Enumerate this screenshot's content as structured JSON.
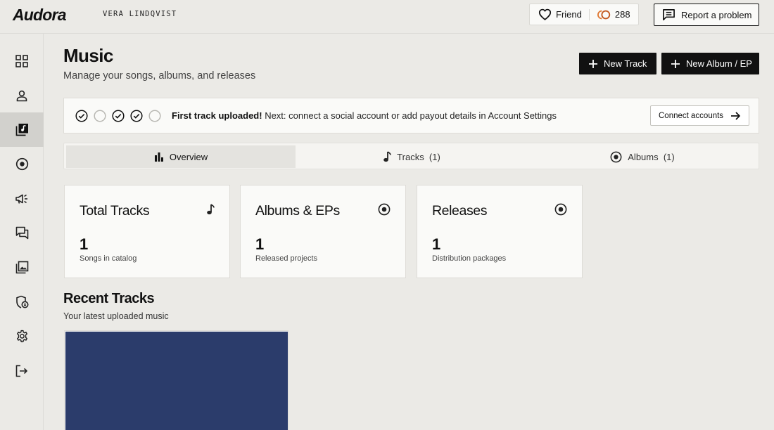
{
  "app": {
    "name": "Audora",
    "user_name": "VERA LINDQVIST"
  },
  "header": {
    "friend_label": "Friend",
    "coins": "288",
    "report_label": "Report a problem"
  },
  "sidebar": {
    "items": [
      {
        "name": "dashboard",
        "icon": "grid-icon",
        "active": false
      },
      {
        "name": "profile",
        "icon": "user-icon",
        "active": false
      },
      {
        "name": "music",
        "icon": "music-library-icon",
        "active": true
      },
      {
        "name": "releases",
        "icon": "disc-icon",
        "active": false
      },
      {
        "name": "promotion",
        "icon": "megaphone-icon",
        "active": false
      },
      {
        "name": "messages",
        "icon": "chat-icon",
        "active": false
      },
      {
        "name": "gallery",
        "icon": "gallery-icon",
        "active": false
      },
      {
        "name": "security",
        "icon": "shield-icon",
        "active": false
      },
      {
        "name": "settings",
        "icon": "gear-icon",
        "active": false
      },
      {
        "name": "logout",
        "icon": "logout-icon",
        "active": false
      }
    ]
  },
  "page": {
    "title": "Music",
    "subtitle": "Manage your songs, albums, and releases",
    "new_track_label": "New Track",
    "new_album_label": "New Album / EP"
  },
  "banner": {
    "steps": [
      true,
      false,
      true,
      true,
      false
    ],
    "highlight": "First track uploaded!",
    "text": " Next: connect a social account or add payout details in Account Settings",
    "connect_label": "Connect accounts"
  },
  "tabs": [
    {
      "label": "Overview",
      "icon": "bar-chart-icon",
      "active": true
    },
    {
      "label": "Tracks  (1)",
      "icon": "music-note-icon",
      "active": false
    },
    {
      "label": "Albums  (1)",
      "icon": "disc-icon",
      "active": false
    }
  ],
  "stats": [
    {
      "title": "Total Tracks",
      "value": "1",
      "desc": "Songs in catalog",
      "icon": "music-note-icon"
    },
    {
      "title": "Albums & EPs",
      "value": "1",
      "desc": "Released projects",
      "icon": "disc-icon"
    },
    {
      "title": "Releases",
      "value": "1",
      "desc": "Distribution packages",
      "icon": "disc-icon"
    }
  ],
  "recent": {
    "title": "Recent Tracks",
    "subtitle": "Your latest uploaded music",
    "art_color": "#2b3c6b"
  },
  "colors": {
    "background": "#ebeae6",
    "card": "#fafaf8",
    "dark_button": "#111111",
    "coin_accent": "#c2571d"
  }
}
